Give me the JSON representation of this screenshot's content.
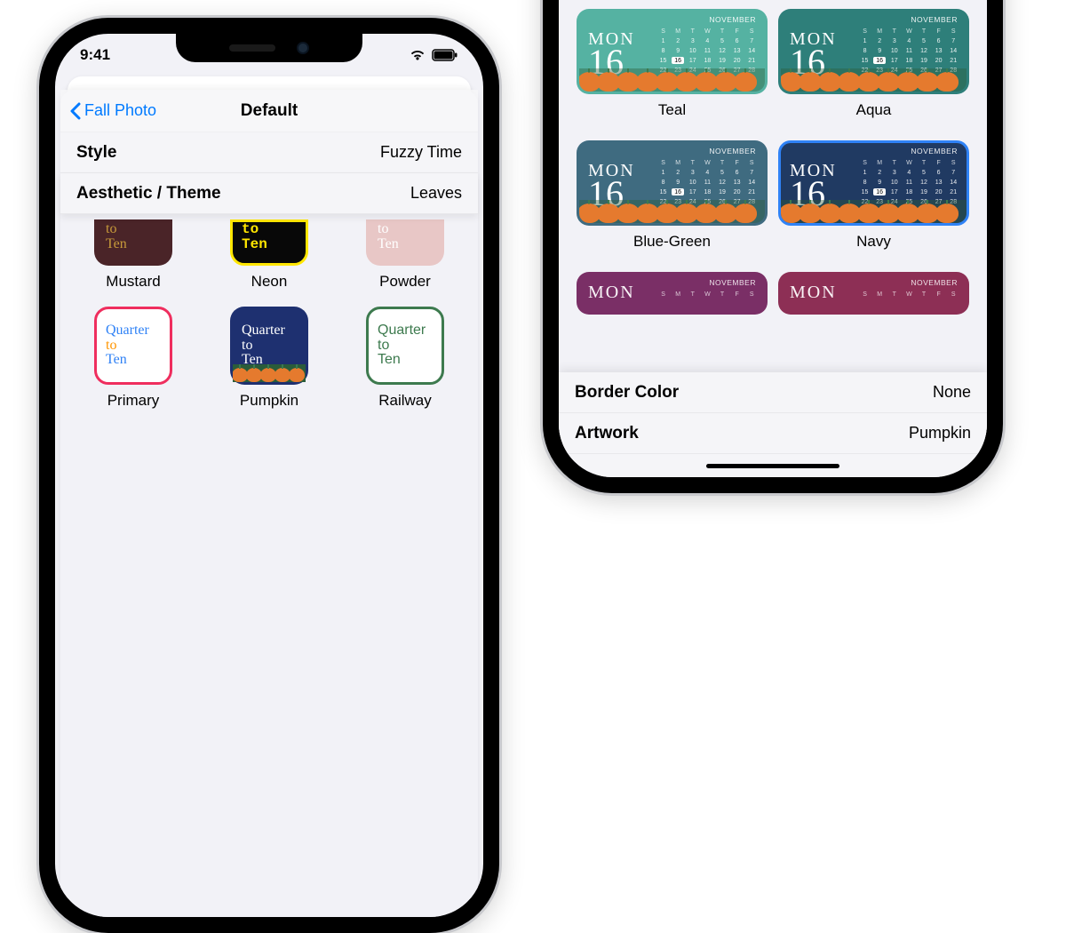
{
  "left": {
    "status_time": "9:41",
    "nav_back": "Fall Photo",
    "nav_title": "Default",
    "rows": {
      "style": {
        "label": "Style",
        "value": "Fuzzy Time"
      },
      "theme": {
        "label": "Aesthetic / Theme",
        "value": "Leaves"
      }
    },
    "tile_text": {
      "line1": "Quarter",
      "line2": "to",
      "line3": "Ten"
    },
    "tile_text_cut": {
      "line2": "to",
      "line3": "Ten"
    },
    "tiles_row1": [
      {
        "name": "Mustard"
      },
      {
        "name": "Neon"
      },
      {
        "name": "Powder"
      }
    ],
    "tiles_row2": [
      {
        "name": "Primary"
      },
      {
        "name": "Pumpkin"
      },
      {
        "name": "Railway"
      }
    ]
  },
  "right": {
    "cal": {
      "dow": "MON",
      "dnum": "16",
      "month": "NOVEMBER",
      "heads": [
        "S",
        "M",
        "T",
        "W",
        "T",
        "F",
        "S"
      ],
      "today": "16"
    },
    "cards_row1": [
      {
        "name": "Teal"
      },
      {
        "name": "Aqua"
      }
    ],
    "cards_row2": [
      {
        "name": "Blue-Green"
      },
      {
        "name": "Navy",
        "selected": true
      }
    ],
    "rows": {
      "border": {
        "label": "Border Color",
        "value": "None"
      },
      "artwork": {
        "label": "Artwork",
        "value": "Pumpkin"
      }
    }
  }
}
